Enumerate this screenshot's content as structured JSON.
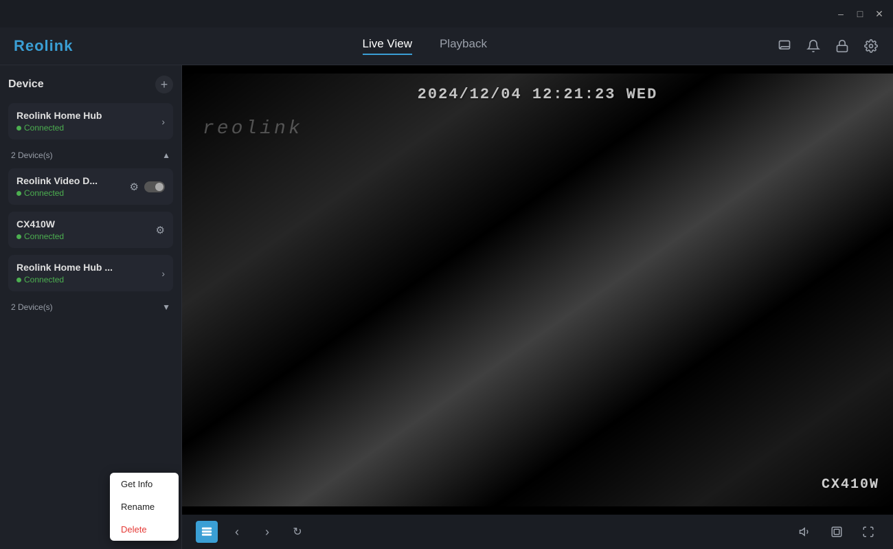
{
  "app": {
    "title": "Reolink",
    "titlebar": {
      "minimize_label": "–",
      "maximize_label": "□",
      "close_label": "✕"
    }
  },
  "header": {
    "logo": "Reolink",
    "nav": {
      "live_view": "Live View",
      "playback": "Playback"
    },
    "icons": {
      "message": "💬",
      "notification": "🔔",
      "lock": "🔒",
      "settings": "⚙"
    }
  },
  "sidebar": {
    "title": "Device",
    "add_label": "+",
    "groups": [
      {
        "name": "Reolink Home Hub",
        "status": "Connected",
        "has_chevron": true,
        "device_count": "2 Device(s)",
        "count_arrow": "▲"
      },
      {
        "name": "Reolink Video D...",
        "status": "Connected",
        "has_toggle": true
      }
    ],
    "cx410w": {
      "name": "CX410W",
      "status": "Connected"
    },
    "groups2": [
      {
        "name": "Reolink Home Hub ...",
        "status": "Connected",
        "has_chevron": true,
        "device_count": "2 Device(s)",
        "count_arrow": "▼"
      }
    ]
  },
  "context_menu": {
    "items": [
      {
        "label": "Get Info",
        "type": "normal"
      },
      {
        "label": "Rename",
        "type": "normal"
      },
      {
        "label": "Delete",
        "type": "danger"
      }
    ]
  },
  "camera": {
    "timestamp": "2024/12/04 12:21:23 WED",
    "watermark": "reolink",
    "label": "CX410W"
  },
  "toolbar": {
    "list_icon": "☰",
    "prev_icon": "‹",
    "next_icon": "›",
    "refresh_icon": "↻",
    "volume_icon": "🔊",
    "window_icon": "⊡",
    "fullscreen_icon": "⛶"
  }
}
